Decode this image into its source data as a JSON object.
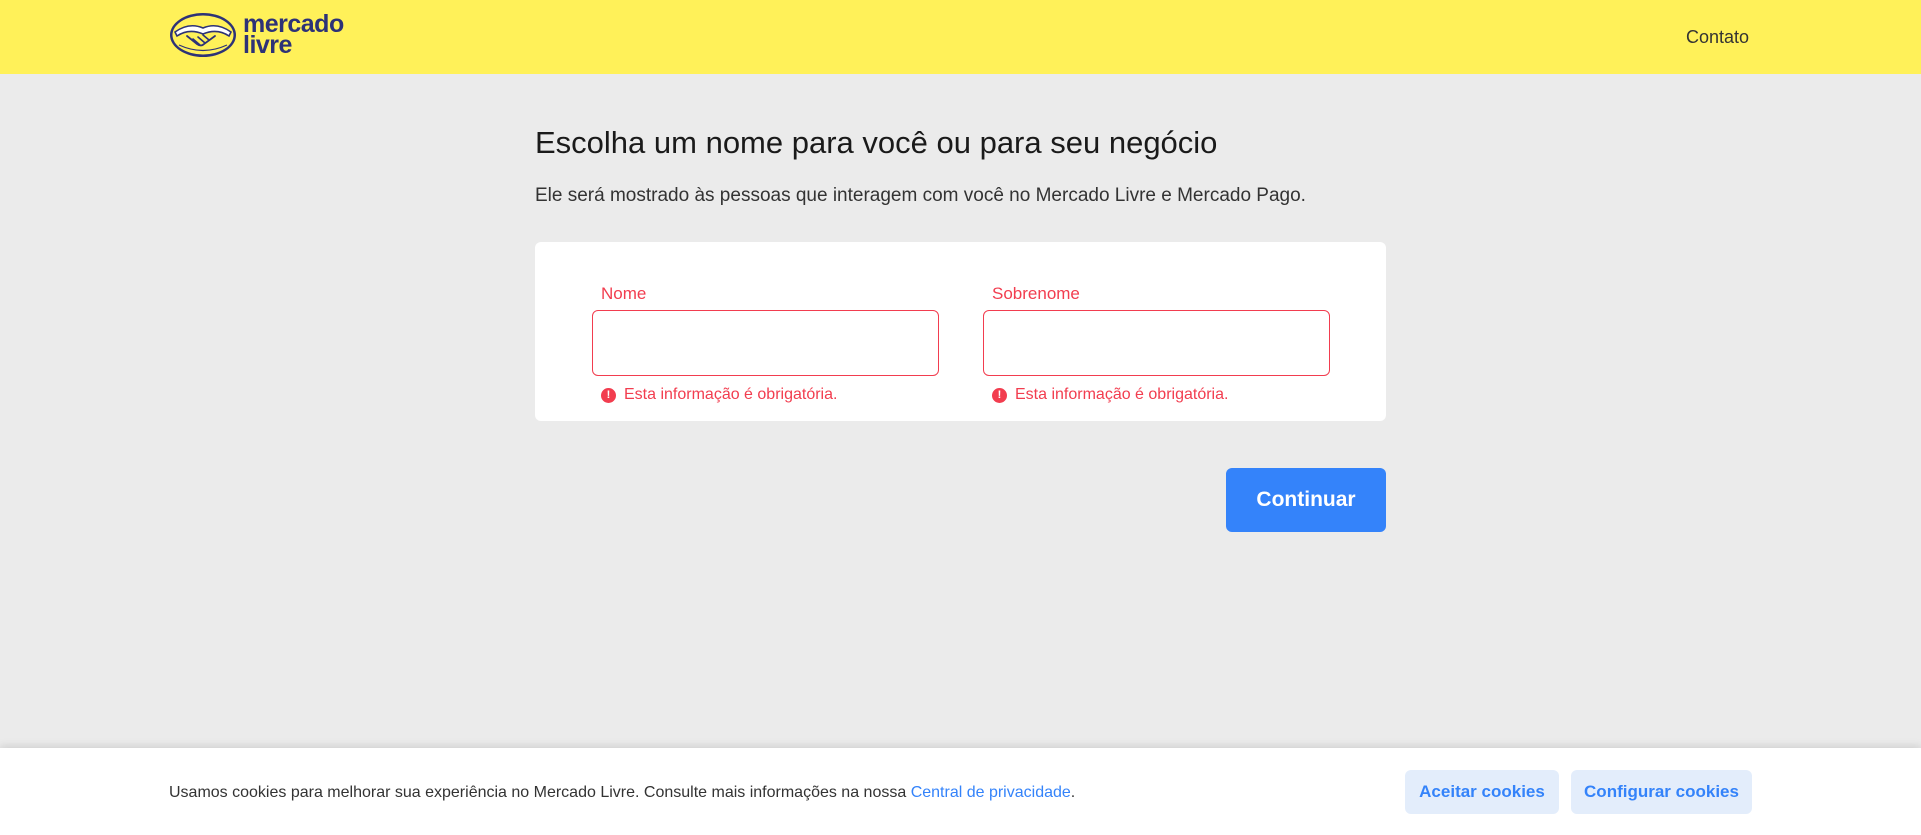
{
  "header": {
    "logo_line1": "mercado",
    "logo_line2": "livre",
    "contact_label": "Contato"
  },
  "main": {
    "title": "Escolha um nome para você ou para seu negócio",
    "subtitle": "Ele será mostrado às pessoas que interagem com você no Mercado Livre e Mercado Pago.",
    "fields": [
      {
        "label": "Nome",
        "value": "",
        "error": "Esta informação é obrigatória."
      },
      {
        "label": "Sobrenome",
        "value": "",
        "error": "Esta informação é obrigatória."
      }
    ],
    "continue_label": "Continuar"
  },
  "cookies": {
    "text": "Usamos cookies para melhorar sua experiência no Mercado Livre. Consulte mais informações na nossa ",
    "link_label": "Central de privacidade",
    "after_link": ".",
    "accept_label": "Aceitar cookies",
    "config_label": "Configurar cookies"
  },
  "colors": {
    "header_bg": "#fff159",
    "primary": "#3483fa",
    "error": "#f23d4f",
    "logo_text": "#2d3277"
  },
  "icons": {
    "logo": "mercado-livre-handshake-icon",
    "error": "exclamation-circle-icon"
  }
}
